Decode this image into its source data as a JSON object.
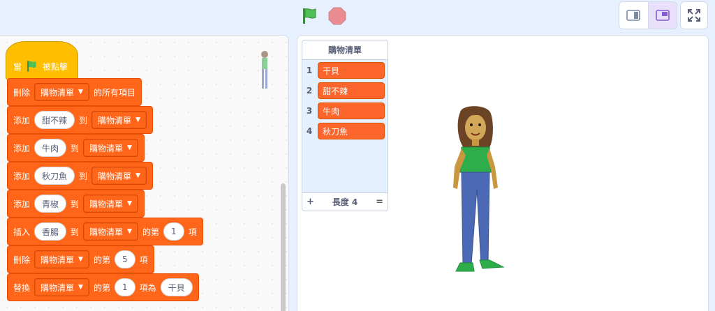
{
  "toolbar": {
    "green_flag": "green-flag-icon",
    "stop": "stop-icon",
    "layout_small": "small-stage-icon",
    "layout_normal": "normal-stage-icon",
    "fullscreen": "fullscreen-icon"
  },
  "script": {
    "hat": {
      "when": "當",
      "clicked": "被點擊"
    },
    "blocks": [
      {
        "verb": "刪除",
        "list": "購物清單",
        "suffix": "的所有項目"
      },
      {
        "verb": "添加",
        "item": "甜不辣",
        "to": "到",
        "list": "購物清單"
      },
      {
        "verb": "添加",
        "item": "牛肉",
        "to": "到",
        "list": "購物清單"
      },
      {
        "verb": "添加",
        "item": "秋刀魚",
        "to": "到",
        "list": "購物清單"
      },
      {
        "verb": "添加",
        "item": "青椒",
        "to": "到",
        "list": "購物清單"
      },
      {
        "verb": "插入",
        "item": "香腸",
        "to": "到",
        "list": "購物清單",
        "of": "的第",
        "index": "1",
        "unit": "項"
      },
      {
        "verb": "刪除",
        "list": "購物清單",
        "of": "的第",
        "index": "5",
        "unit": "項"
      },
      {
        "verb": "替換",
        "list": "購物清單",
        "of": "的第",
        "index": "1",
        "as": "項為",
        "item": "干貝"
      }
    ]
  },
  "stage": {
    "list_monitor": {
      "title": "購物清單",
      "items": [
        {
          "index": "1",
          "value": "干貝"
        },
        {
          "index": "2",
          "value": "甜不辣"
        },
        {
          "index": "3",
          "value": "牛肉"
        },
        {
          "index": "4",
          "value": "秋刀魚"
        }
      ],
      "add": "+",
      "length_label": "長度 4",
      "resize": "="
    }
  },
  "colors": {
    "motion_orange": "#ff661a",
    "event_yellow": "#ffbf00",
    "flag_green": "#4cbf56",
    "stop_red": "#ec5959"
  }
}
